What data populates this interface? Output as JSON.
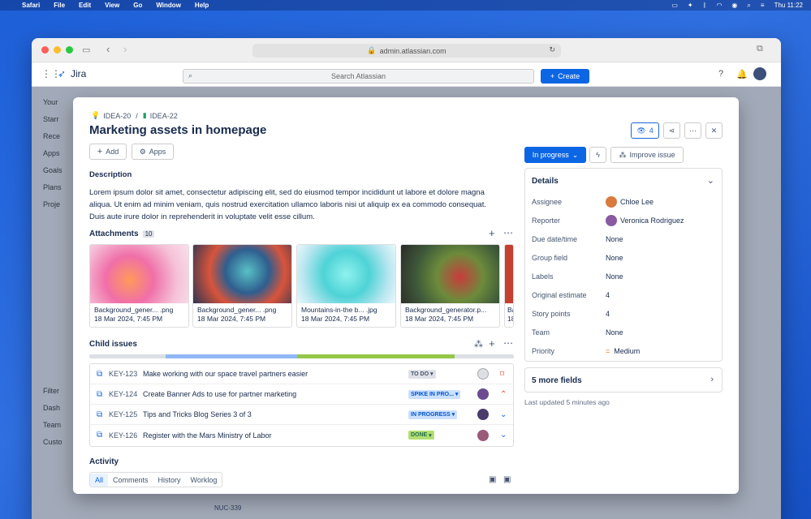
{
  "menubar": {
    "apple": "",
    "items": [
      "Safari",
      "File",
      "Edit",
      "View",
      "Go",
      "Window",
      "Help"
    ],
    "clock": "Thu 11:22"
  },
  "browser": {
    "url": "admin.atlassian.com"
  },
  "jira": {
    "logo": "Jira",
    "search_placeholder": "Search Atlassian",
    "create": "Create"
  },
  "sidebar": [
    "Your",
    "Starr",
    "Rece",
    "Apps",
    "Goals",
    "Plans",
    "Proje",
    "Filter",
    "Dash",
    "Team",
    "Custo"
  ],
  "breadcrumb": {
    "parent": "IDEA-20",
    "sep": "/",
    "current": "IDEA-22"
  },
  "issue": {
    "title": "Marketing assets in homepage",
    "add": "Add",
    "apps": "Apps",
    "description_heading": "Description",
    "description": "Lorem ipsum dolor sit amet, consectetur adipiscing elit, sed do eiusmod tempor incididunt ut labore et dolore magna aliqua. Ut enim ad minim veniam, quis nostrud exercitation ullamco laboris nisi ut aliquip ex ea commodo consequat. Duis aute irure dolor in reprehenderit in voluptate velit esse cillum.",
    "watch_count": "4"
  },
  "attachments": {
    "heading": "Attachments",
    "count": "10",
    "items": [
      {
        "name": "Background_gener... .png",
        "date": "18 Mar 2024, 7:45 PM"
      },
      {
        "name": "Background_gener... .png",
        "date": "18 Mar 2024, 7:45 PM"
      },
      {
        "name": "Mountains-in-the b... .jpg",
        "date": "18 Mar 2024, 7:45 PM"
      },
      {
        "name": "Background_generator.p...",
        "date": "18 Mar 2024, 7:45 PM"
      },
      {
        "name": "Ba",
        "date": "18"
      }
    ]
  },
  "child_issues": {
    "heading": "Child issues",
    "progress": {
      "done": 0.18,
      "in_progress": 0.31,
      "todo_green": 0.37
    },
    "items": [
      {
        "key": "KEY-123",
        "summary": "Make working with our space travel partners easier",
        "status": "TO DO",
        "priority": "high"
      },
      {
        "key": "KEY-124",
        "summary": "Create Banner Ads to use for partner marketing",
        "status": "SPIKE IN PRO...",
        "priority": "medium-high"
      },
      {
        "key": "KEY-125",
        "summary": "Tips and Tricks Blog Series 3 of 3",
        "status": "IN PROGRESS",
        "priority": "low"
      },
      {
        "key": "KEY-126",
        "summary": "Register with the Mars Ministry of Labor",
        "status": "DONE",
        "priority": "low"
      }
    ]
  },
  "activity": {
    "heading": "Activity",
    "tabs": [
      "All",
      "Comments",
      "History",
      "Worklog"
    ]
  },
  "status_button": "In progress",
  "improve": "Improve issue",
  "details": {
    "heading": "Details",
    "fields": [
      {
        "label": "Assignee",
        "value": "Chloe Lee"
      },
      {
        "label": "Reporter",
        "value": "Veronica Rodriguez"
      },
      {
        "label": "Due date/time",
        "value": "None"
      },
      {
        "label": "Group field",
        "value": "None"
      },
      {
        "label": "Labels",
        "value": "None"
      },
      {
        "label": "Original estimate",
        "value": "4"
      },
      {
        "label": "Story points",
        "value": "4"
      },
      {
        "label": "Team",
        "value": "None"
      },
      {
        "label": "Priority",
        "value": "Medium"
      }
    ]
  },
  "more_fields": "5 more fields",
  "last_updated": "Last updated 5 minutes ago",
  "background_row": {
    "key": "NUC-339"
  }
}
